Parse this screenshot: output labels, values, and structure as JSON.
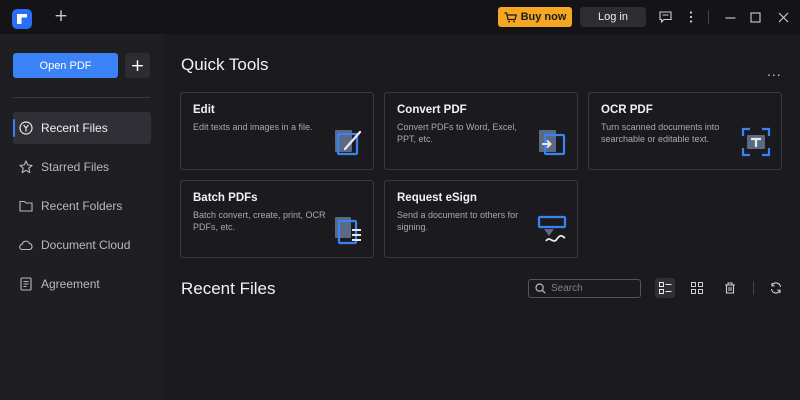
{
  "titlebar": {
    "new_tab": "+",
    "buy_label": "Buy now",
    "login_label": "Log in",
    "icons": [
      "cart-icon",
      "feedback-icon",
      "more-vertical-icon",
      "minimize-icon",
      "maximize-icon",
      "close-icon"
    ]
  },
  "sidebar": {
    "open_pdf_label": "Open PDF",
    "add_label": "+",
    "items": [
      {
        "label": "Recent Files",
        "icon": "recent-icon",
        "active": true
      },
      {
        "label": "Starred Files",
        "icon": "star-icon",
        "active": false
      },
      {
        "label": "Recent Folders",
        "icon": "folder-icon",
        "active": false
      },
      {
        "label": "Document Cloud",
        "icon": "cloud-icon",
        "active": false
      },
      {
        "label": "Agreement",
        "icon": "agreement-icon",
        "active": false
      }
    ]
  },
  "quick_tools": {
    "title": "Quick Tools",
    "more": "...",
    "cards": [
      {
        "title": "Edit",
        "desc": "Edit texts and images in a file.",
        "icon": "edit-icon"
      },
      {
        "title": "Convert PDF",
        "desc": "Convert PDFs to Word, Excel, PPT, etc.",
        "icon": "convert-icon"
      },
      {
        "title": "OCR PDF",
        "desc": "Turn scanned documents into searchable or editable text.",
        "icon": "ocr-icon"
      },
      {
        "title": "Batch PDFs",
        "desc": "Batch convert, create, print, OCR PDFs, etc.",
        "icon": "batch-icon"
      },
      {
        "title": "Request eSign",
        "desc": "Send a document to others for signing.",
        "icon": "esign-icon"
      }
    ]
  },
  "recent_files": {
    "title": "Recent Files",
    "search_placeholder": "Search",
    "view_mode": "list"
  },
  "colors": {
    "accent": "#3b82f6",
    "buy": "#f5a623",
    "background": "#1b1b1f",
    "sidebar": "#1f1f23"
  }
}
